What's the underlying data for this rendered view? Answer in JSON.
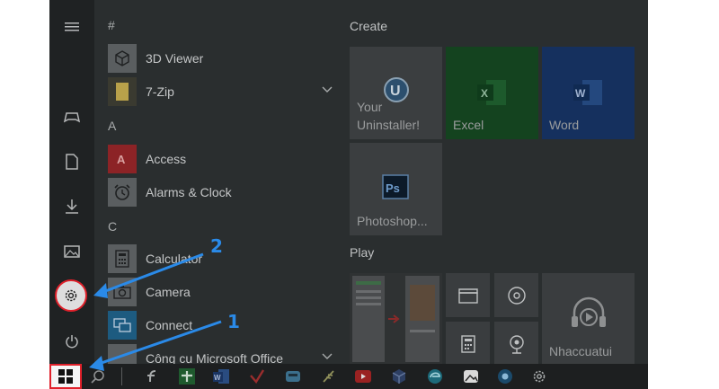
{
  "app_list": {
    "sections": [
      {
        "letter": "#",
        "apps": [
          {
            "label": "3D Viewer",
            "icon": "3d-viewer-icon",
            "color": "#5a5e60"
          },
          {
            "label": "7-Zip",
            "icon": "folder-icon",
            "color": "#b9a14a",
            "expandable": true
          }
        ]
      },
      {
        "letter": "A",
        "apps": [
          {
            "label": "Access",
            "icon": "access-icon",
            "color": "#8c2326"
          },
          {
            "label": "Alarms & Clock",
            "icon": "alarm-clock-icon",
            "color": "#5a5e60"
          }
        ]
      },
      {
        "letter": "C",
        "apps": [
          {
            "label": "Calculator",
            "icon": "calculator-icon",
            "color": "#5a5e60"
          },
          {
            "label": "Camera",
            "icon": "camera-icon",
            "color": "#5a5e60"
          },
          {
            "label": "Connect",
            "icon": "connect-icon",
            "color": "#1d5b80"
          },
          {
            "label": "Công cụ Microsoft Office",
            "icon": "office-tools-icon",
            "color": "#5a5e60",
            "expandable": true
          }
        ]
      }
    ]
  },
  "create_group": {
    "title": "Create",
    "tiles": [
      {
        "label": "Your Uninstaller!",
        "icon": "uninstaller-icon",
        "color": "#3b3e40"
      },
      {
        "label": "Excel",
        "icon": "excel-icon",
        "color": "#14431f"
      },
      {
        "label": "Word",
        "icon": "word-icon",
        "color": "#15305e"
      },
      {
        "label": "Photoshop...",
        "icon": "photoshop-icon",
        "color": "#3b3e40"
      }
    ]
  },
  "play_group": {
    "title": "Play",
    "small_tiles": [
      "movies-icon",
      "groove-icon",
      "calculator-icon",
      "webcam-icon"
    ],
    "big_tile_label": "Nhaccuatui"
  },
  "annotations": {
    "callout_1": "1",
    "callout_2": "2",
    "arrow_color": "#2a8ae8",
    "highlight_color": "#e0202a"
  }
}
